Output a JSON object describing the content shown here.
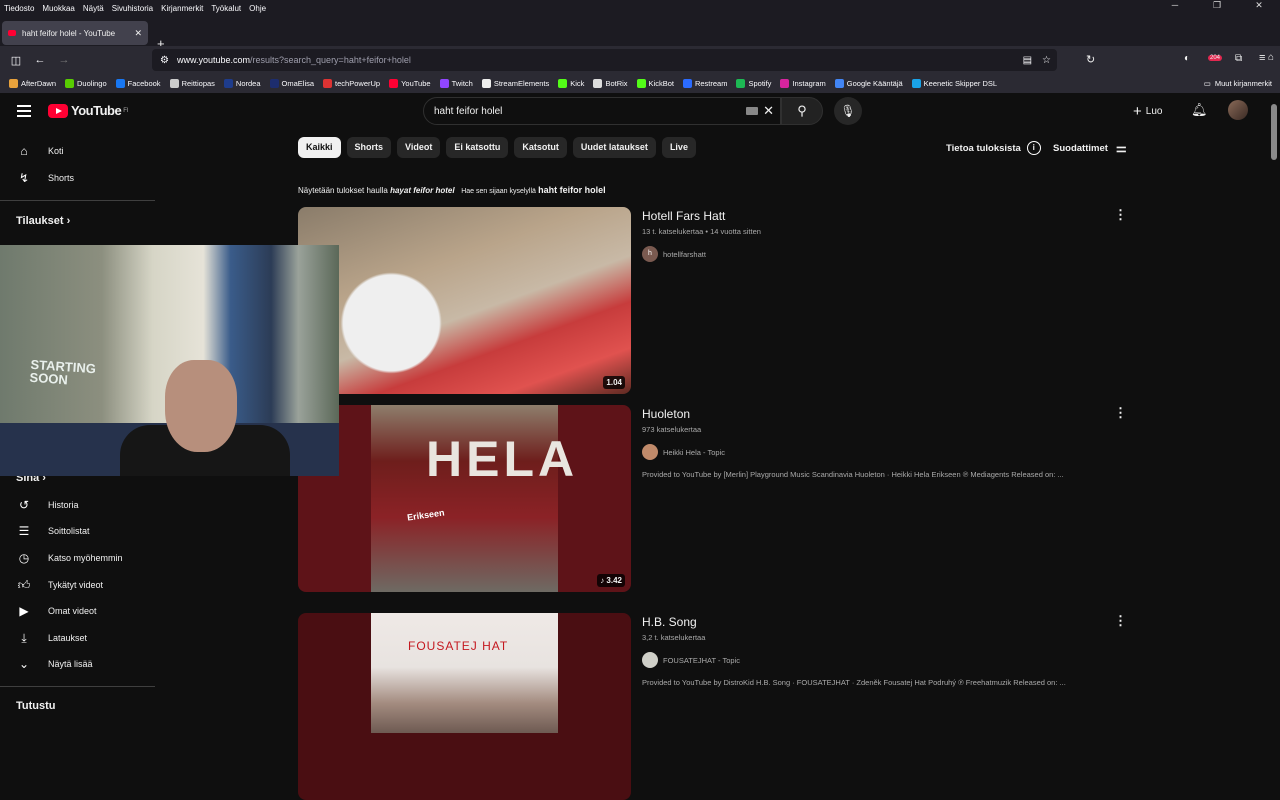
{
  "menubar": {
    "items": [
      "Tiedosto",
      "Muokkaa",
      "Näytä",
      "Sivuhistoria",
      "Kirjanmerkit",
      "Työkalut",
      "Ohje"
    ]
  },
  "tab": {
    "title": "haht feifor holel - YouTube"
  },
  "url": {
    "host": "www.youtube.com",
    "path": "/results?search_query=haht+feifor+holel"
  },
  "ext_badge": "204",
  "bookmarks": [
    {
      "label": "AfterDawn",
      "color": "#e8a23c"
    },
    {
      "label": "Duolingo",
      "color": "#58cc02"
    },
    {
      "label": "Facebook",
      "color": "#1877f2"
    },
    {
      "label": "Reittiopas",
      "color": "#cccccc"
    },
    {
      "label": "Nordea",
      "color": "#1e3c8c"
    },
    {
      "label": "OmaElisa",
      "color": "#1d2d6e"
    },
    {
      "label": "techPowerUp",
      "color": "#d33"
    },
    {
      "label": "YouTube",
      "color": "#ff0033"
    },
    {
      "label": "Twitch",
      "color": "#9146ff"
    },
    {
      "label": "StreamElements",
      "color": "#eeeeee"
    },
    {
      "label": "Kick",
      "color": "#53fc18"
    },
    {
      "label": "BotRix",
      "color": "#dddddd"
    },
    {
      "label": "KickBot",
      "color": "#53fc18"
    },
    {
      "label": "Restream",
      "color": "#2b6bff"
    },
    {
      "label": "Spotify",
      "color": "#1db954"
    },
    {
      "label": "Instagram",
      "color": "#d6249f"
    },
    {
      "label": "Google Kääntäjä",
      "color": "#4285f4"
    },
    {
      "label": "Keenetic Skipper DSL",
      "color": "#1aa3e8"
    }
  ],
  "bookmarks_other": "Muut kirjanmerkit",
  "yt": {
    "logo": "YouTube",
    "region": "FI",
    "search_value": "haht feifor holel",
    "create": "Luo"
  },
  "sidebar": {
    "home": "Koti",
    "shorts": "Shorts",
    "subs": "Tilaukset",
    "you": "Sinä",
    "history": "Historia",
    "playlists": "Soittolistat",
    "watch_later": "Katso myöhemmin",
    "liked": "Tykätyt videot",
    "your_videos": "Omat videot",
    "downloads": "Lataukset",
    "show_more": "Näytä lisää",
    "explore": "Tutustu"
  },
  "webcam": {
    "sign_line1": "STARTING",
    "sign_line2": "SOON"
  },
  "chips": [
    "Kaikki",
    "Shorts",
    "Videot",
    "Ei katsottu",
    "Katsotut",
    "Uudet lataukset",
    "Live"
  ],
  "about": "Tietoa tuloksista",
  "filters": "Suodattimet",
  "correction": {
    "prefix": "Näytetään tulokset haulla",
    "hayat": "hayat",
    "rest": "feifor hotel",
    "instead": "Hae sen sijaan kyselyllä",
    "original": "haht feifor holel"
  },
  "results": [
    {
      "title": "Hotell Fars Hatt",
      "meta": "13 t. katselukertaa • 14 vuotta sitten",
      "channel": "hotellfarshatt",
      "duration": "1.04",
      "desc": ""
    },
    {
      "title": "Huoleton",
      "meta": "973 katselukertaa",
      "channel": "Heikki Hela - Topic",
      "duration": "♪ 3.42",
      "desc": "Provided to YouTube by [Merlin] Playground Music Scandinavia Huoleton · Heikki Hela Erikseen ℗ Mediagents Released on: ...",
      "album_text": "HELA",
      "album_sub": "Erikseen"
    },
    {
      "title": "H.B. Song",
      "meta": "3,2 t. katselukertaa",
      "channel": "FOUSATEJHAT - Topic",
      "duration": "",
      "desc": "Provided to YouTube by DistroKid H.B. Song · FOUSATEJHAT · Zdeněk Fousatej Hat Podruhý ℗ Freehatmuzik Released on: ...",
      "album_text": "FOUSATEJ HAT"
    }
  ]
}
